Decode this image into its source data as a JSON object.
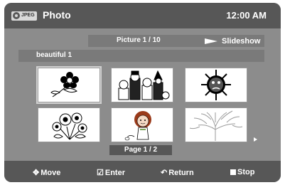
{
  "header": {
    "badge_text": "JPEG",
    "title": "Photo",
    "clock": "12:00 AM"
  },
  "info": {
    "picture_counter": "Picture 1 / 10",
    "slideshow_label": "Slideshow"
  },
  "file": {
    "name": "beautiful 1"
  },
  "thumbnails": [
    {
      "subject": "flower-drawing"
    },
    {
      "subject": "group-cartoon"
    },
    {
      "subject": "sun-face"
    },
    {
      "subject": "flowers-bunch"
    },
    {
      "subject": "girl-cartoon"
    },
    {
      "subject": "tree-drawing"
    }
  ],
  "pagination": {
    "label": "Page 1 / 2"
  },
  "footer": {
    "move": "Move",
    "enter": "Enter",
    "return": "Return",
    "stop": "Stop"
  },
  "colors": {
    "panel": "#8c8c8c",
    "bar": "#575757",
    "strip": "#7a7a7a",
    "text": "#ffffff"
  }
}
